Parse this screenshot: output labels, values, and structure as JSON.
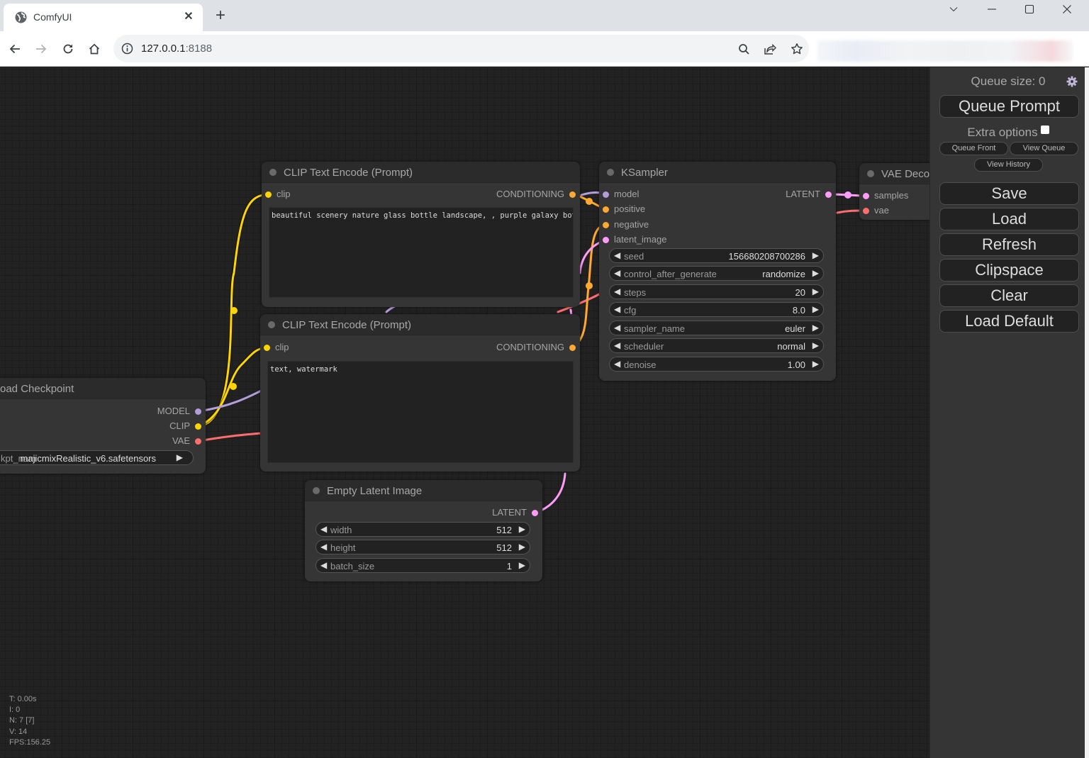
{
  "browser": {
    "tab_title": "ComfyUI",
    "url_host": "127.0.0.1",
    "url_port": ":8188",
    "icons": {
      "favicon": "globe-icon",
      "tab_close": "close-icon",
      "new_tab": "plus-icon",
      "tab_search": "chevron-down-icon",
      "minimize": "minimize-icon",
      "maximize": "maximize-icon",
      "close_window": "close-icon",
      "back": "arrow-left-icon",
      "forward": "arrow-right-icon",
      "reload": "reload-icon",
      "home": "home-icon",
      "site_info": "info-icon",
      "zoom": "search-icon",
      "share": "share-icon",
      "bookmark": "star-icon"
    },
    "glyphs": {
      "tab_close": "✕",
      "new_tab": "+"
    }
  },
  "graph": {
    "nodes": {
      "clip_pos": {
        "title": "CLIP Text Encode (Prompt)",
        "input": "clip",
        "output": "CONDITIONING",
        "text": "beautiful scenery nature glass bottle landscape, , purple galaxy bottle,"
      },
      "clip_neg": {
        "title": "CLIP Text Encode (Prompt)",
        "input": "clip",
        "output": "CONDITIONING",
        "text": "text, watermark"
      },
      "ksampler": {
        "title": "KSampler",
        "inputs": [
          "model",
          "positive",
          "negative",
          "latent_image"
        ],
        "output": "LATENT",
        "widgets": [
          {
            "label": "seed",
            "value": "156680208700286"
          },
          {
            "label": "control_after_generate",
            "value": "randomize"
          },
          {
            "label": "steps",
            "value": "20"
          },
          {
            "label": "cfg",
            "value": "8.0"
          },
          {
            "label": "sampler_name",
            "value": "euler"
          },
          {
            "label": "scheduler",
            "value": "normal"
          },
          {
            "label": "denoise",
            "value": "1.00"
          }
        ]
      },
      "vae_decode": {
        "title": "VAE Deco",
        "inputs": [
          "samples",
          "vae"
        ]
      },
      "checkpoint": {
        "title": "oad Checkpoint",
        "outputs": [
          "MODEL",
          "CLIP",
          "VAE"
        ],
        "widget": {
          "label": "kpt_nam",
          "value": "majicmixRealistic_v6.safetensors"
        }
      },
      "empty_latent": {
        "title": "Empty Latent Image",
        "output": "LATENT",
        "widgets": [
          {
            "label": "width",
            "value": "512"
          },
          {
            "label": "height",
            "value": "512"
          },
          {
            "label": "batch_size",
            "value": "1"
          }
        ]
      }
    },
    "arrows": {
      "left": "◀",
      "right": "▶"
    },
    "type_colors": {
      "MODEL": "#b39ddb",
      "CLIP": "#ffd500",
      "VAE": "#ff6e6e",
      "CONDITIONING": "#ffa931",
      "LATENT": "#ff9cf9"
    },
    "stats": {
      "t": "T: 0.00s",
      "i": "I: 0",
      "n": "N: 7 [7]",
      "v": "V: 14",
      "fps": "FPS:156.25"
    }
  },
  "menu": {
    "queue_size": "Queue size: 0",
    "queue_prompt": "Queue Prompt",
    "extra_options": "Extra options",
    "extra_options_checked": false,
    "queue_front": "Queue Front",
    "view_queue": "View Queue",
    "view_history": "View History",
    "save": "Save",
    "load": "Load",
    "refresh": "Refresh",
    "clipspace": "Clipspace",
    "clear": "Clear",
    "load_default": "Load Default",
    "settings_icon": "gear-icon"
  }
}
